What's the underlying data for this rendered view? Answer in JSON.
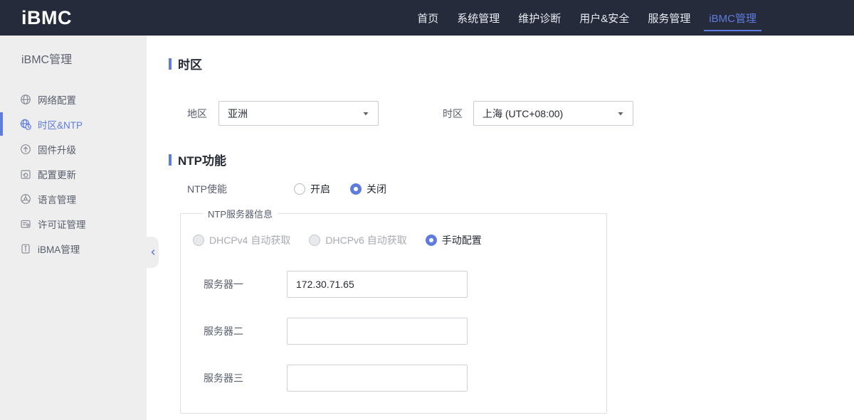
{
  "navbar": {
    "logo": "iBMC",
    "items": [
      {
        "label": "首页",
        "active": false
      },
      {
        "label": "系统管理",
        "active": false
      },
      {
        "label": "维护诊断",
        "active": false
      },
      {
        "label": "用户&安全",
        "active": false
      },
      {
        "label": "服务管理",
        "active": false
      },
      {
        "label": "iBMC管理",
        "active": true
      }
    ]
  },
  "sidebar": {
    "title": "iBMC管理",
    "items": [
      {
        "label": "网络配置",
        "icon": "network-icon",
        "active": false
      },
      {
        "label": "时区&NTP",
        "icon": "timezone-icon",
        "active": true
      },
      {
        "label": "固件升级",
        "icon": "firmware-upgrade-icon",
        "active": false
      },
      {
        "label": "配置更新",
        "icon": "config-update-icon",
        "active": false
      },
      {
        "label": "语言管理",
        "icon": "language-icon",
        "active": false
      },
      {
        "label": "许可证管理",
        "icon": "license-icon",
        "active": false
      },
      {
        "label": "iBMA管理",
        "icon": "ibma-icon",
        "active": false
      }
    ],
    "collapse_icon": "chevron-left-icon"
  },
  "main": {
    "timezone_section": {
      "title": "时区",
      "region_label": "地区",
      "region_value": "亚洲",
      "timezone_label": "时区",
      "timezone_value": "上海 (UTC+08:00)"
    },
    "ntp_section": {
      "title": "NTP功能",
      "enable_label": "NTP使能",
      "enable_options": [
        {
          "label": "开启",
          "selected": false
        },
        {
          "label": "关闭",
          "selected": true
        }
      ],
      "server_group": {
        "legend": "NTP服务器信息",
        "mode_options": [
          {
            "label": "DHCPv4 自动获取",
            "selected": false,
            "disabled": true
          },
          {
            "label": "DHCPv6 自动获取",
            "selected": false,
            "disabled": true
          },
          {
            "label": "手动配置",
            "selected": true,
            "disabled": false
          }
        ],
        "servers": [
          {
            "label": "服务器一",
            "value": "172.30.71.65"
          },
          {
            "label": "服务器二",
            "value": ""
          },
          {
            "label": "服务器三",
            "value": ""
          }
        ]
      }
    }
  },
  "colors": {
    "accent": "#5e7ce0",
    "navbar_bg": "#252b3a",
    "sidebar_bg": "#eeeeee"
  }
}
